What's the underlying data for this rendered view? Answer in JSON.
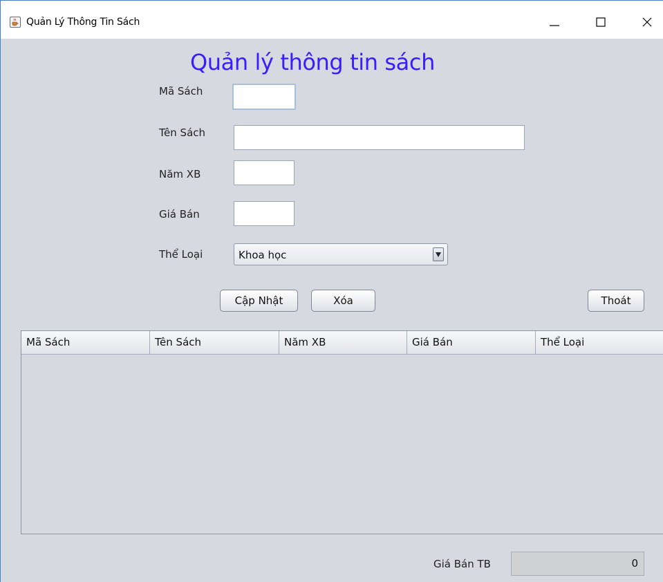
{
  "window": {
    "title": "Quản Lý Thông Tin Sách"
  },
  "form": {
    "heading": "Quản lý thông tin sách",
    "ma_sach_label": "Mã Sách",
    "ma_sach_value": "",
    "ten_sach_label": "Tên Sách",
    "ten_sach_value": "",
    "nam_xb_label": "Năm XB",
    "nam_xb_value": "",
    "gia_ban_label": "Giá Bán",
    "gia_ban_value": "",
    "the_loai_label": "Thể Loại",
    "the_loai_selected": "Khoa học"
  },
  "buttons": {
    "update": "Cập Nhật",
    "delete": "Xóa",
    "exit": "Thoát"
  },
  "table": {
    "columns": [
      "Mã Sách",
      "Tên Sách",
      "Năm XB",
      "Giá Bán",
      "Thể Loại"
    ],
    "rows": []
  },
  "footer": {
    "avg_price_label": "Giá Bán TB",
    "avg_price_value": "0"
  },
  "icons": {
    "app": "java-cup-icon",
    "minimize": "minimize-icon",
    "maximize": "maximize-icon",
    "close": "close-icon",
    "combo": "triangle-down-icon"
  },
  "colors": {
    "heading": "#3b1cff",
    "background": "#d6d9df",
    "window_border": "#4a7cc7"
  }
}
